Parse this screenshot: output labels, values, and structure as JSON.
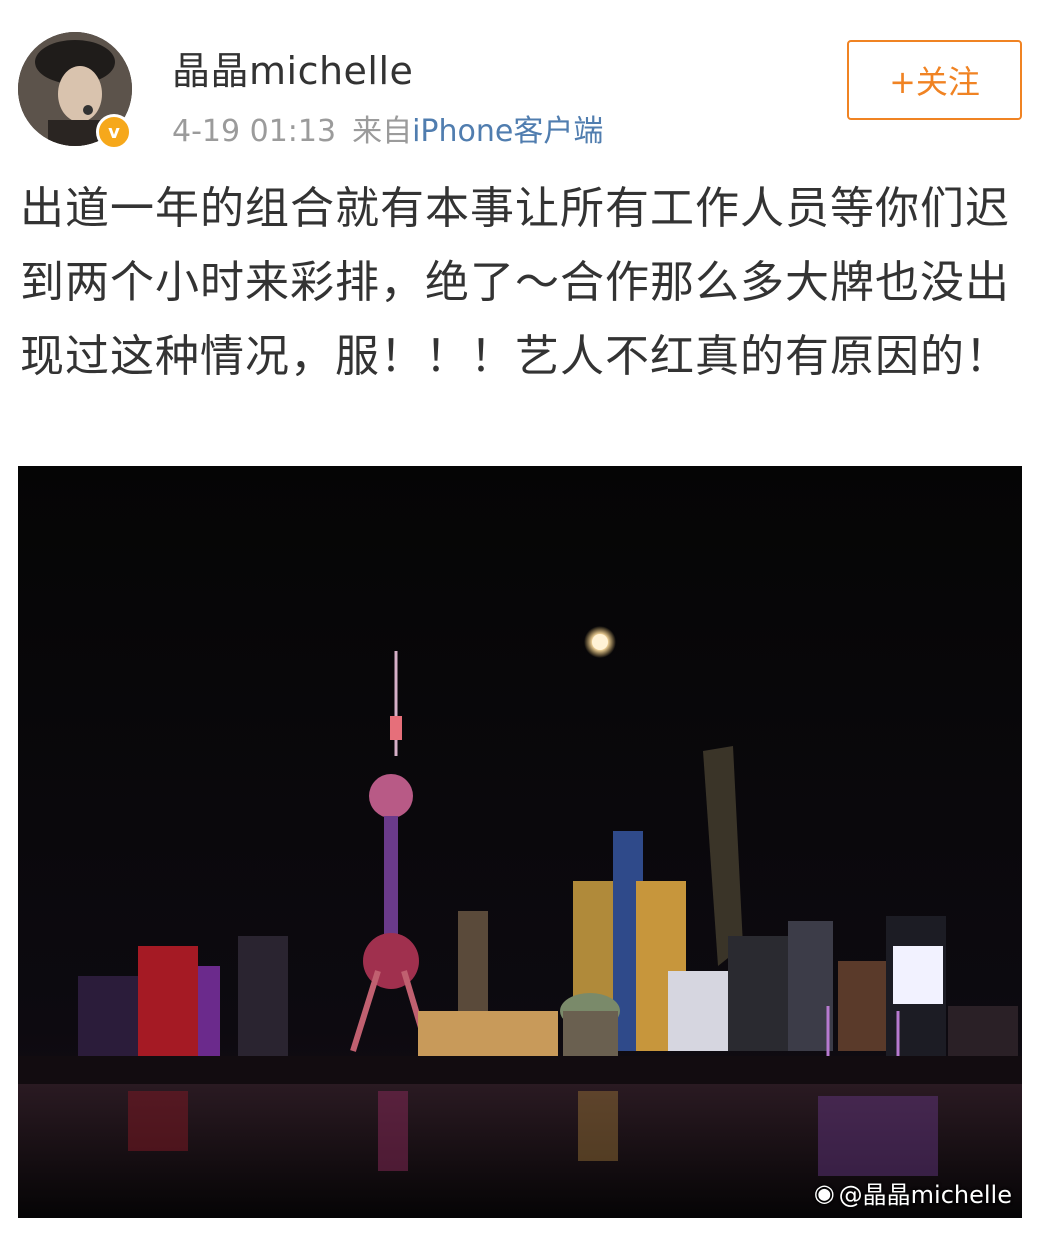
{
  "post": {
    "username": "晶晶michelle",
    "time": "4-19 01:13",
    "source_prefix": "来自",
    "source_client": "iPhone客户端",
    "follow_label": "+关注",
    "verified_badge": "v",
    "content": "出道一年的组合就有本事让所有工作人员等你们迟到两个小时来彩排，绝了～合作那么多大牌也没出现过这种情况，服！！！艺人不红真的有原因的！"
  },
  "photo": {
    "watermark": "@晶晶michelle",
    "watermark_icon": "weibo-logo-icon"
  },
  "colors": {
    "follow": "#f08323",
    "client_link": "#507daf",
    "badge": "#f6a81b"
  }
}
